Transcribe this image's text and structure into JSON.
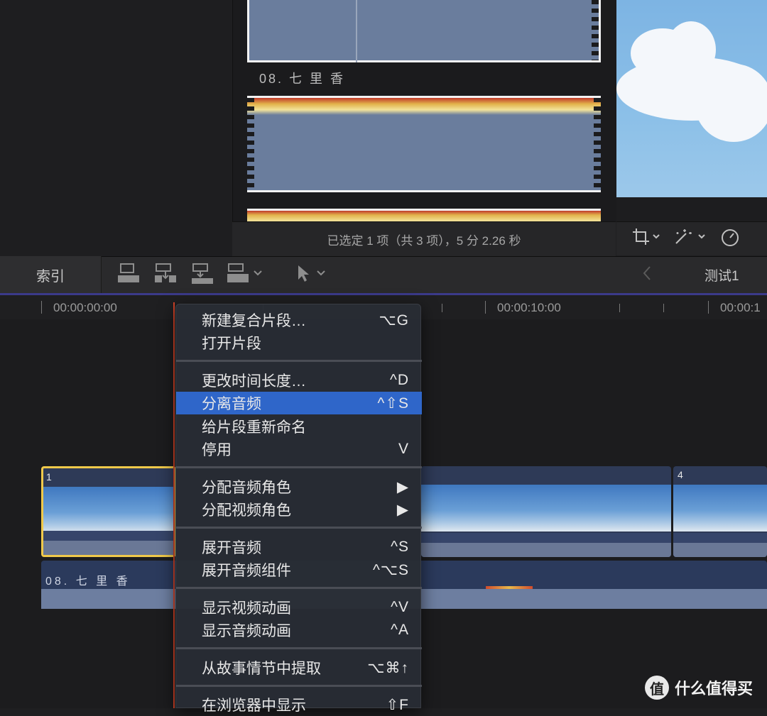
{
  "browser": {
    "clip_label": "08. 七 里 香",
    "status": "已选定 1 项（共 3 项），5 分 2.26 秒"
  },
  "toolbar": {
    "index_label": "索引",
    "project_name": "测试1",
    "back_icon": "chevron-left-icon",
    "tools": [
      "append-clip-icon",
      "insert-clip-icon",
      "connect-clip-icon",
      "overwrite-clip-icon",
      "select-tool-icon"
    ]
  },
  "viewer_tools": [
    "crop-icon",
    "magic-wand-icon",
    "speed-gauge-icon"
  ],
  "timeline": {
    "timecodes": [
      "00:00:00:00",
      "00:00:10:00",
      "00:00:1"
    ],
    "clip_numbers": [
      "1",
      "4"
    ],
    "audio_label": "08. 七 里 香"
  },
  "context_menu": {
    "items": [
      {
        "label": "新建复合片段…",
        "shortcut": "⌥G"
      },
      {
        "label": "打开片段",
        "shortcut": ""
      },
      {
        "label": "更改时间长度…",
        "shortcut": "^D"
      },
      {
        "label": "分离音频",
        "shortcut": "^⇧S",
        "highlighted": true
      },
      {
        "label": "给片段重新命名",
        "shortcut": ""
      },
      {
        "label": "停用",
        "shortcut": "V"
      },
      {
        "label": "分配音频角色",
        "shortcut": "▶"
      },
      {
        "label": "分配视频角色",
        "shortcut": "▶"
      },
      {
        "label": "展开音频",
        "shortcut": "^S"
      },
      {
        "label": "展开音频组件",
        "shortcut": "^⌥S"
      },
      {
        "label": "显示视频动画",
        "shortcut": "^V"
      },
      {
        "label": "显示音频动画",
        "shortcut": "^A"
      },
      {
        "label": "从故事情节中提取",
        "shortcut": "⌥⌘↑"
      },
      {
        "label": "在浏览器中显示",
        "shortcut": "⇧F"
      }
    ]
  },
  "watermark": {
    "badge": "值",
    "text": "什么值得买"
  },
  "colors": {
    "accent": "#3b3a8a",
    "playhead": "#d6452a",
    "selection": "#f0c94a",
    "menu_highlight": "#2f66c9"
  }
}
